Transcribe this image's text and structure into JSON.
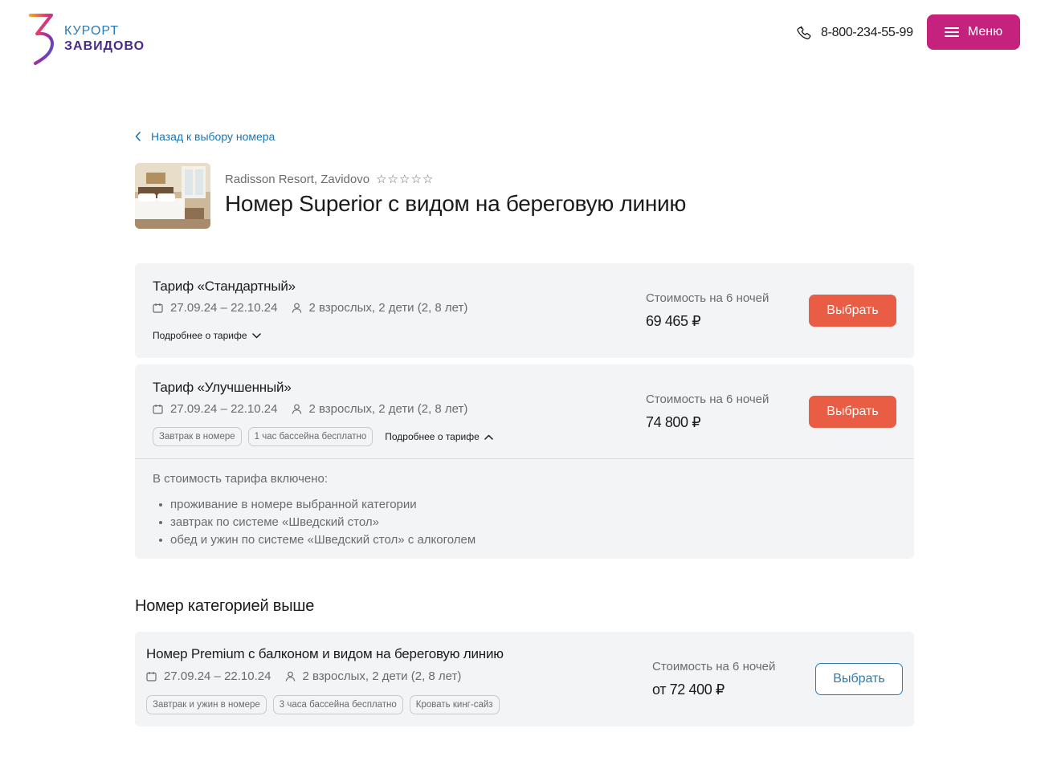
{
  "header": {
    "logo_top": "КУРОРТ",
    "logo_bottom": "ЗАВИДОВО",
    "phone": "8-800-234-55-99",
    "menu_label": "Меню"
  },
  "back_link": "Назад к выбору номера",
  "room": {
    "hotel": "Radisson Resort, Zavidovo",
    "stars": [
      "☆",
      "☆",
      "☆",
      "☆",
      "☆"
    ],
    "title": "Номер Superior с видом на береговую линию"
  },
  "tariffs": [
    {
      "title": "Тариф «Стандартный»",
      "dates": "27.09.24 – 22.10.24",
      "guests": "2 взрослых, 2 дети (2, 8 лет)",
      "details_label": "Подробнее о тарифе",
      "price_label": "Стоимость на 6 ночей",
      "price": "69 465 ₽",
      "button": "Выбрать"
    },
    {
      "title": "Тариф «Улучшенный»",
      "dates": "27.09.24 – 22.10.24",
      "guests": "2 взрослых, 2 дети (2, 8 лет)",
      "tags": [
        "Завтрак в номере",
        "1 час бассейна бесплатно"
      ],
      "details_label": "Подробнее о тарифе",
      "price_label": "Стоимость на 6 ночей",
      "price": "74 800 ₽",
      "button": "Выбрать",
      "included_title": "В стоимость тарифа включено:",
      "included": [
        "проживание в номере выбранной категории",
        "завтрак по системе «Шведский стол»",
        "обед и ужин по системе «Шведский стол» с алкоголем"
      ]
    }
  ],
  "upgrade": {
    "section_title": "Номер категорией выше",
    "title": "Номер Premium с балконом и видом на береговую линию",
    "dates": "27.09.24 – 22.10.24",
    "guests": "2 взрослых, 2 дети (2, 8 лет)",
    "tags": [
      "Завтрак и ужин в номере",
      "3 часа бассейна бесплатно",
      "Кровать кинг-сайз"
    ],
    "price_label": "Стоимость на 6 ночей",
    "price": "от 72 400 ₽",
    "button": "Выбрать"
  },
  "colors": {
    "brand_magenta": "#c4227c",
    "cta_red": "#e85d43",
    "link_blue": "#1b75b5",
    "card_bg": "#f3f4f6"
  }
}
